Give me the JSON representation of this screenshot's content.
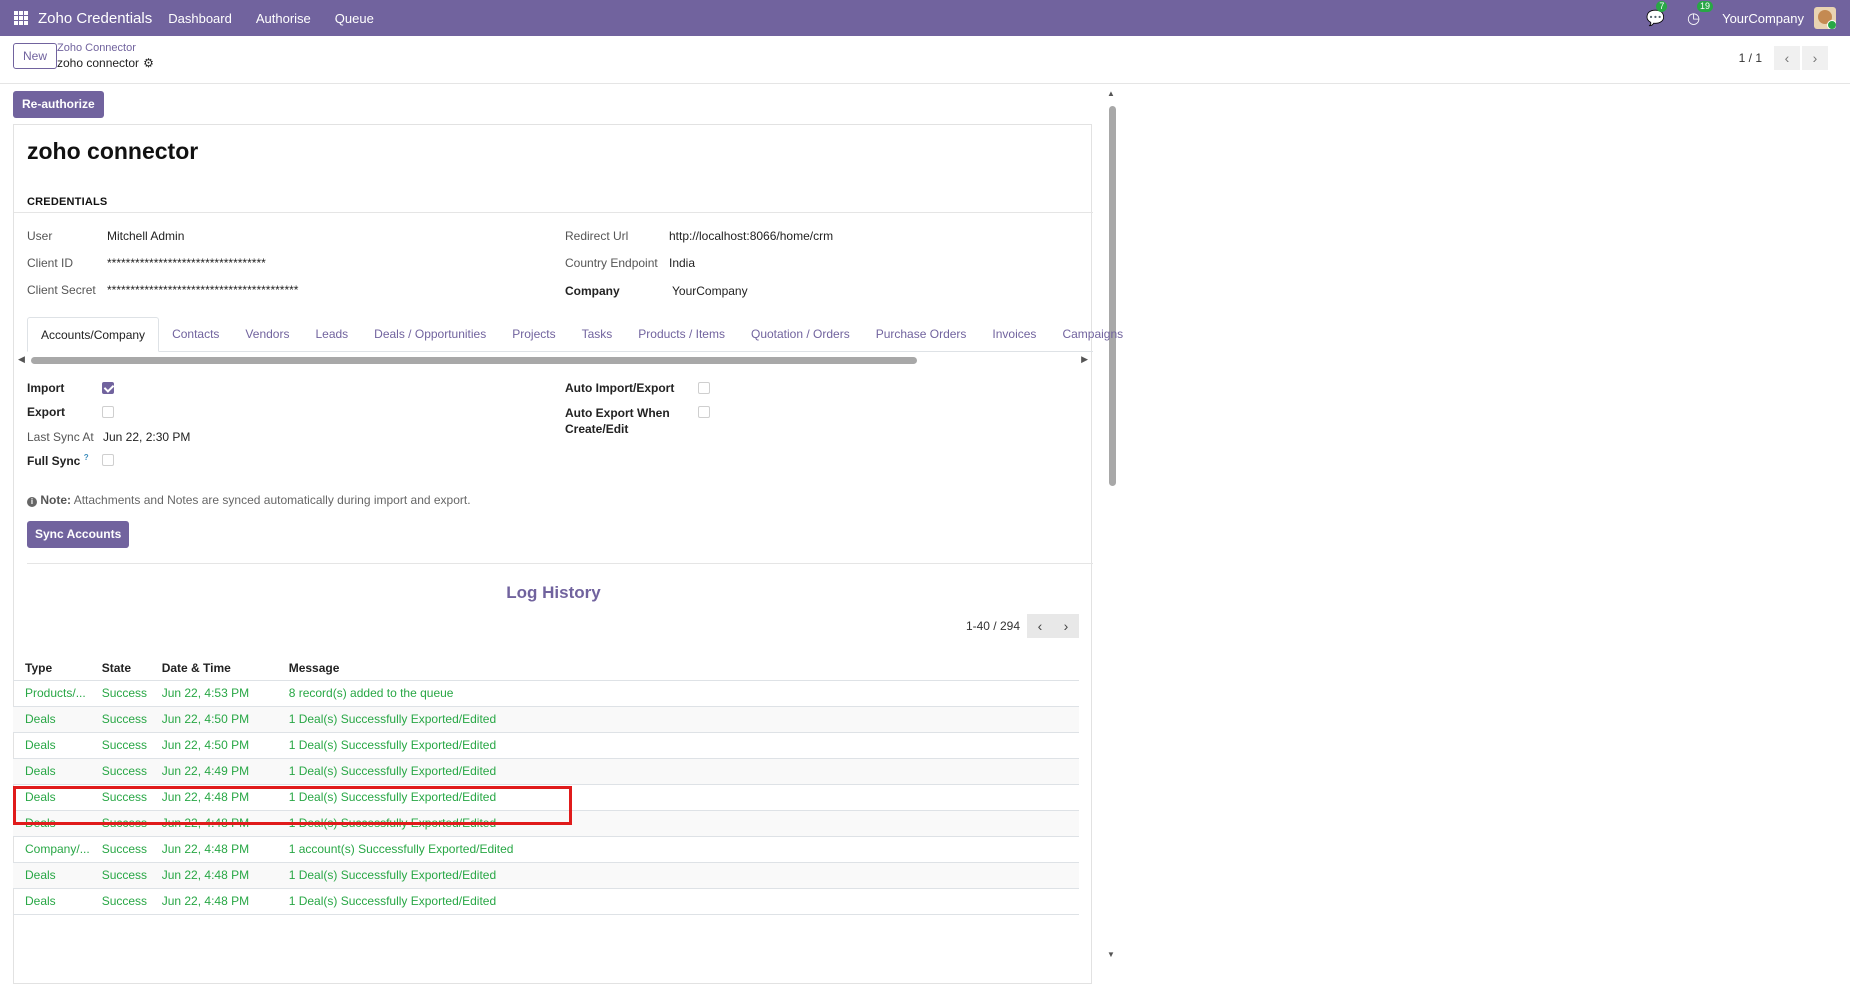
{
  "navbar": {
    "app_title": "Zoho Credentials",
    "menu": [
      "Dashboard",
      "Authorise",
      "Queue"
    ],
    "messages_badge": "7",
    "activities_badge": "19",
    "company": "YourCompany"
  },
  "control_panel": {
    "new_label": "New",
    "breadcrumb_parent": "Zoho Connector",
    "breadcrumb_current": "zoho connector",
    "pager_value": "1 / 1"
  },
  "form": {
    "reauthorize_label": "Re-authorize",
    "title": "zoho connector",
    "section_credentials": "CREDENTIALS",
    "fields": {
      "user_label": "User",
      "user_value": "Mitchell Admin",
      "client_id_label": "Client ID",
      "client_id_value": "**********************************",
      "client_secret_label": "Client Secret",
      "client_secret_value": "*****************************************",
      "redirect_label": "Redirect Url",
      "redirect_value": "http://localhost:8066/home/crm",
      "country_label": "Country Endpoint",
      "country_value": "India",
      "company_label": "Company",
      "company_value": "YourCompany"
    },
    "tabs": [
      "Accounts/Company",
      "Contacts",
      "Vendors",
      "Leads",
      "Deals / Opportunities",
      "Projects",
      "Tasks",
      "Products / Items",
      "Quotation / Orders",
      "Purchase Orders",
      "Invoices",
      "Campaigns"
    ],
    "tab_content": {
      "import_label": "Import",
      "import_checked": true,
      "export_label": "Export",
      "export_checked": false,
      "last_sync_label": "Last Sync At",
      "last_sync_value": "Jun 22, 2:30 PM",
      "full_sync_label": "Full Sync",
      "full_sync_help": "?",
      "full_sync_checked": false,
      "auto_import_label": "Auto Import/Export",
      "auto_import_checked": false,
      "auto_export_label_1": "Auto Export When",
      "auto_export_label_2": "Create/Edit",
      "auto_export_checked": false,
      "note_label": "Note:",
      "note_text": " Attachments and Notes are synced automatically during import and export.",
      "sync_button": "Sync Accounts"
    },
    "log": {
      "title": "Log History",
      "pager_value": "1-40 / 294",
      "headers": [
        "Type",
        "State",
        "Date & Time",
        "Message"
      ],
      "rows": [
        {
          "type": "Products/...",
          "state": "Success",
          "date": "Jun 22, 4:53 PM",
          "message": "8 record(s) added to the queue"
        },
        {
          "type": "Deals",
          "state": "Success",
          "date": "Jun 22, 4:50 PM",
          "message": "1 Deal(s) Successfully Exported/Edited"
        },
        {
          "type": "Deals",
          "state": "Success",
          "date": "Jun 22, 4:50 PM",
          "message": "1 Deal(s) Successfully Exported/Edited"
        },
        {
          "type": "Deals",
          "state": "Success",
          "date": "Jun 22, 4:49 PM",
          "message": "1 Deal(s) Successfully Exported/Edited"
        },
        {
          "type": "Deals",
          "state": "Success",
          "date": "Jun 22, 4:48 PM",
          "message": "1 Deal(s) Successfully Exported/Edited"
        },
        {
          "type": "Deals",
          "state": "Success",
          "date": "Jun 22, 4:48 PM",
          "message": "1 Deal(s) Successfully Exported/Edited"
        },
        {
          "type": "Company/...",
          "state": "Success",
          "date": "Jun 22, 4:48 PM",
          "message": "1 account(s) Successfully Exported/Edited"
        },
        {
          "type": "Deals",
          "state": "Success",
          "date": "Jun 22, 4:48 PM",
          "message": "1 Deal(s) Successfully Exported/Edited"
        },
        {
          "type": "Deals",
          "state": "Success",
          "date": "Jun 22, 4:48 PM",
          "message": "1 Deal(s) Successfully Exported/Edited"
        }
      ]
    }
  },
  "colors": {
    "brand": "#71639e",
    "success": "#28a745",
    "highlight": "#e01b1b"
  }
}
